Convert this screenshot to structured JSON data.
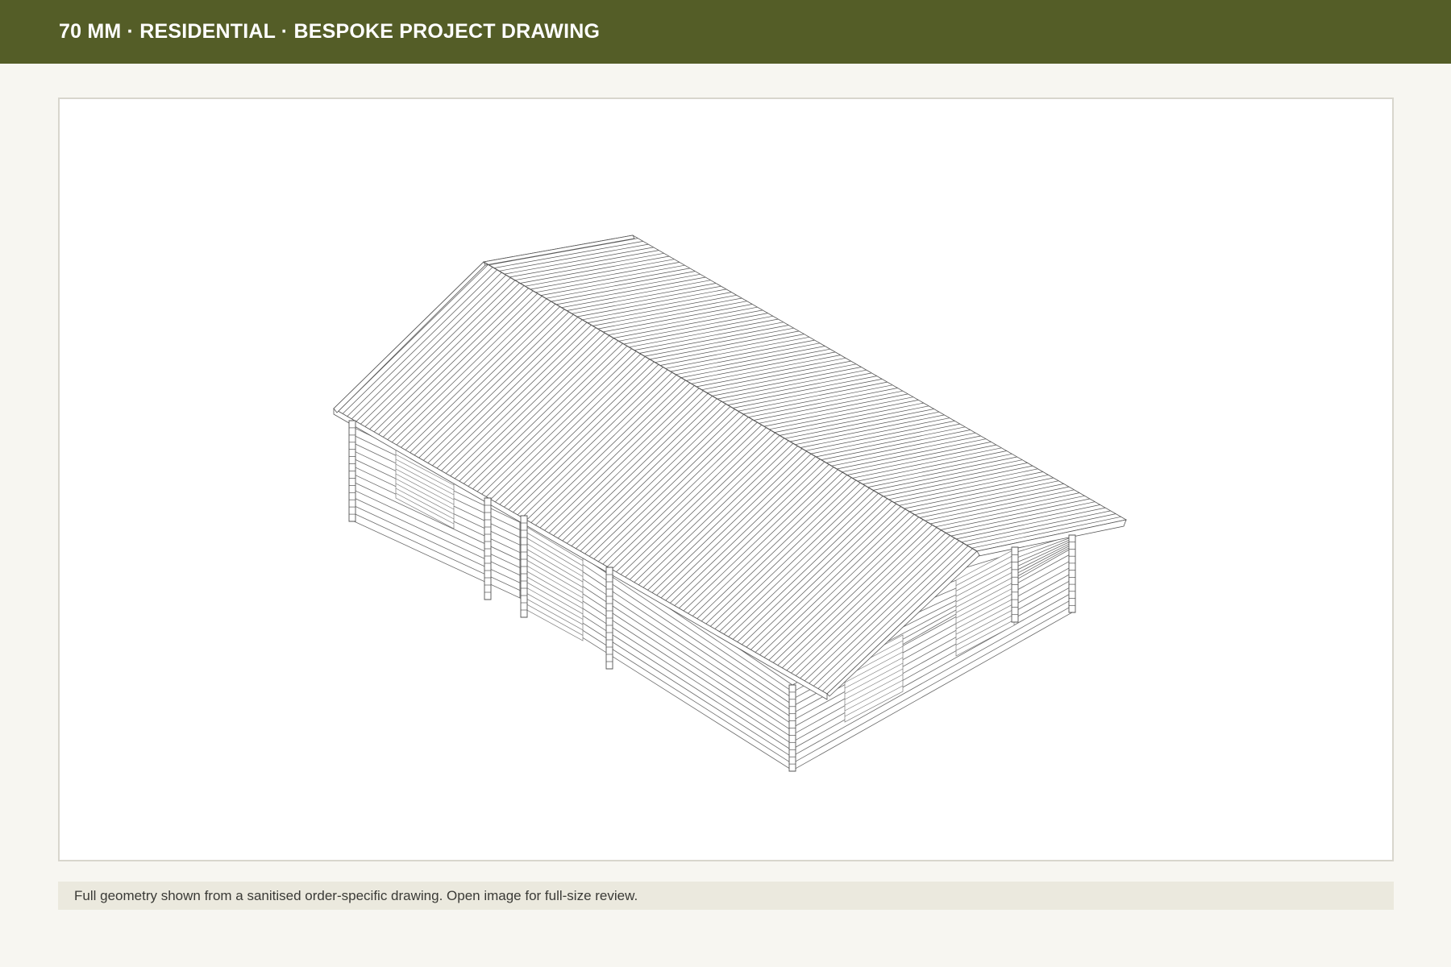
{
  "header": {
    "title": "70 MM · RESIDENTIAL · BESPOKE PROJECT DRAWING",
    "background": "#545d27"
  },
  "drawing": {
    "subject": "isometric-log-cabin-line-drawing",
    "line_color": "#555555"
  },
  "caption": {
    "text": "Full geometry shown from a sanitised order-specific drawing. Open image for full-size review."
  }
}
